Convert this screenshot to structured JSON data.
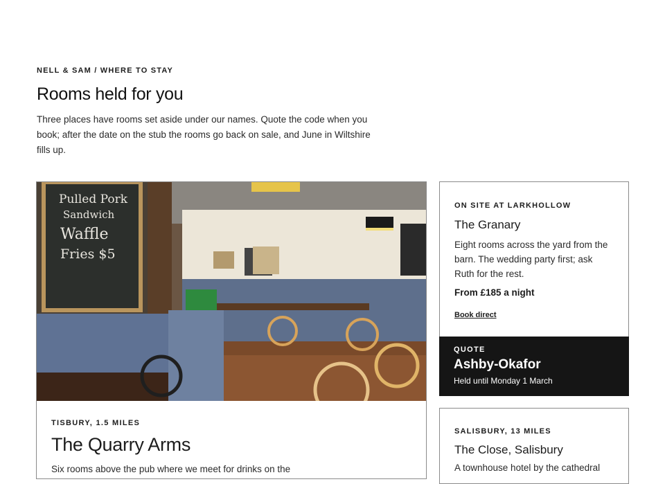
{
  "header": {
    "eyebrow": "NELL & SAM / WHERE TO STAY",
    "title": "Rooms held for you",
    "intro": "Three places have rooms set aside under our names. Quote the code when you book; after the date on the stub the rooms go back on sale, and June in Wiltshire fills up."
  },
  "main_card": {
    "location": "TISBURY, 1.5 MILES",
    "name": "The Quarry Arms",
    "description": "Six rooms above the pub where we meet for drinks on the",
    "photo": {
      "chalkboard_lines": [
        "Pulled Pork",
        "Sandwich",
        "Waffle",
        "Fries $5"
      ]
    }
  },
  "side_card": {
    "location": "ON SITE AT LARKHOLLOW",
    "name": "The Granary",
    "description": "Eight rooms across the yard from the barn. The wedding party first; ask Ruth for the rest.",
    "price": "From £185 a night",
    "link_label": "Book direct",
    "quote": {
      "label": "QUOTE",
      "code": "Ashby-Okafor",
      "held": "Held until Monday 1 March"
    }
  },
  "side_card_2": {
    "location": "SALISBURY, 13 MILES",
    "name": "The Close, Salisbury",
    "description": "A townhouse hotel by the cathedral"
  }
}
